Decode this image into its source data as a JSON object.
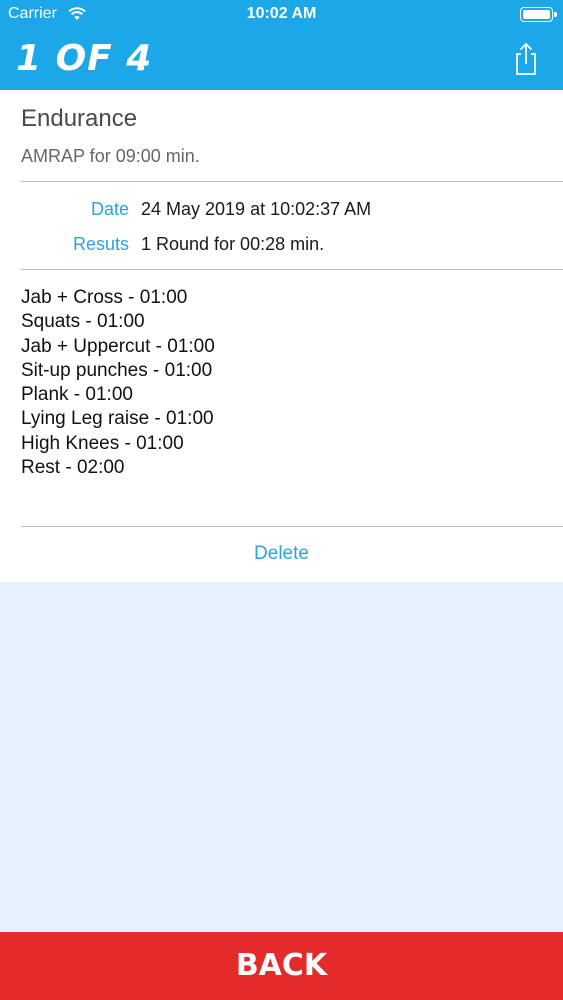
{
  "status_bar": {
    "carrier": "Carrier",
    "time": "10:02 AM"
  },
  "nav": {
    "title": "1 OF 4",
    "share_icon": "share-icon"
  },
  "workout": {
    "name": "Endurance",
    "description": "AMRAP for 09:00 min.",
    "date_label": "Date",
    "date_value": "24 May 2019 at 10:02:37 AM",
    "results_label": "Resuts",
    "results_value": "1 Round for 00:28 min.",
    "exercises": [
      "Jab + Cross - 01:00",
      "Squats - 01:00",
      "Jab + Uppercut - 01:00",
      "Sit-up punches - 01:00",
      "Plank - 01:00",
      "Lying Leg raise - 01:00",
      "High Knees - 01:00",
      "Rest - 02:00"
    ],
    "delete_label": "Delete"
  },
  "back_label": "BACK",
  "colors": {
    "accent": "#1ca7e8",
    "link": "#2aa3e0",
    "danger": "#e42b2b",
    "background": "#e4f2fc"
  }
}
